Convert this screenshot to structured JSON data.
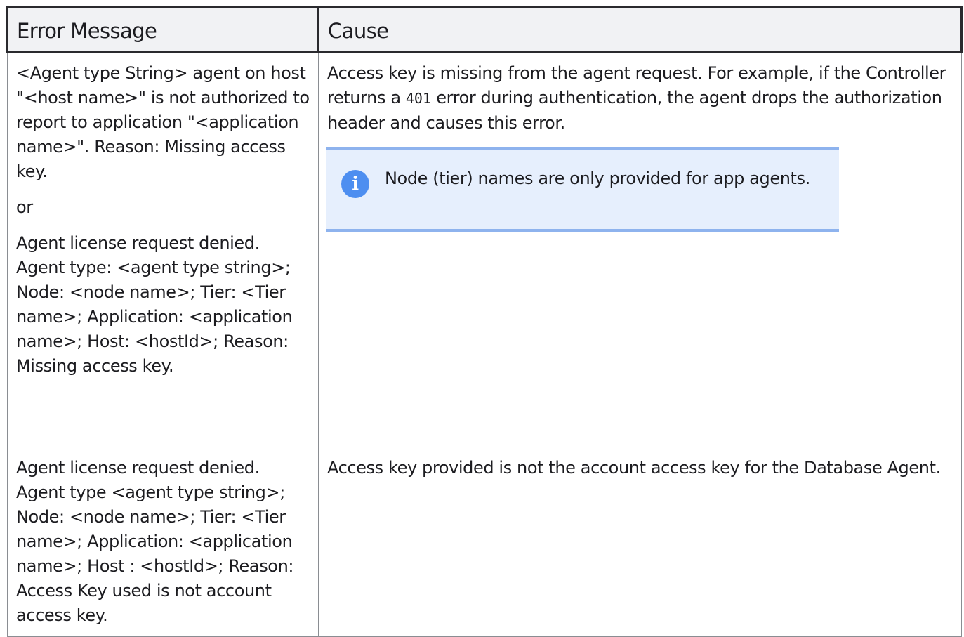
{
  "table": {
    "headers": [
      "Error Message",
      "Cause"
    ],
    "rows": [
      {
        "error_paragraphs": [
          "<Agent type String> agent on host \"<host name>\" is not authorized to report to application \"<application name>\". Reason: Missing access key.",
          "or",
          "Agent license request denied. Agent type: <agent type string>; Node: <node name>; Tier: <Tier name>; Application: <application name>; Host: <hostId>; Reason: Missing access key."
        ],
        "cause_before_code": "Access key is missing from the agent request. For example, if the Controller returns a ",
        "cause_code": "401",
        "cause_after_code": " error during authentication, the agent drops the authorization header and causes this error.",
        "note": {
          "icon": "info-icon",
          "icon_glyph": "i",
          "text": "Node (tier) names are only provided for app agents.",
          "background_color": "#e6effd",
          "border_color": "#8eb3ee",
          "icon_color": "#4d8ef0"
        }
      },
      {
        "error_paragraphs": [
          "Agent license request denied. Agent type <agent type string>; Node: <node name>; Tier: <Tier name>; Application: <application name>; Host : <hostId>; Reason: Access Key used is not account access key."
        ],
        "cause": "Access key provided is not the account access key for the Database Agent."
      }
    ]
  },
  "colors": {
    "header_background": "#f1f2f4",
    "header_border": "#2a2a2e",
    "cell_border": "#8a8d92",
    "text": "#1c1c20"
  }
}
